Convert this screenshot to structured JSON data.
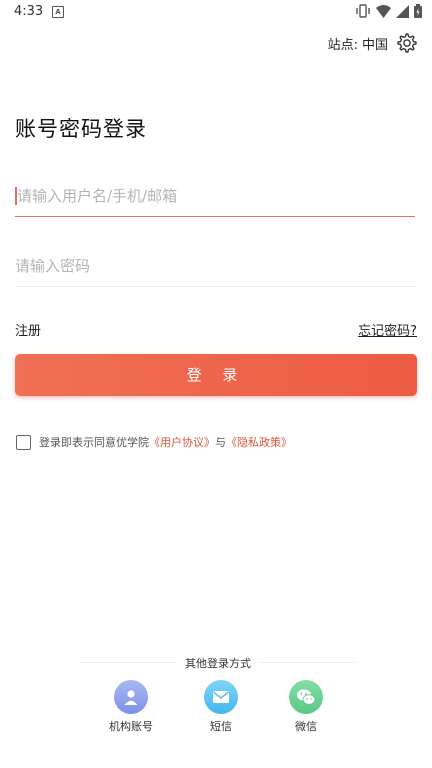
{
  "status_bar": {
    "time": "4:33",
    "notification_letter": "A"
  },
  "site": {
    "label": "站点:",
    "value": "中国"
  },
  "title": "账号密码登录",
  "username_field": {
    "value": "",
    "placeholder": "请输入用户名/手机/邮箱"
  },
  "password_field": {
    "value": "",
    "placeholder": "请输入密码"
  },
  "links": {
    "register": "注册",
    "forgot": "忘记密码?"
  },
  "login_button": "登 录",
  "agreement": {
    "checked": false,
    "prefix": "登录即表示同意优学院",
    "user_agreement": "《用户协议》",
    "conjunction": "与",
    "privacy_policy": "《隐私政策》"
  },
  "other_login": {
    "title": "其他登录方式",
    "methods": [
      {
        "label": "机构账号",
        "icon": "person-icon",
        "color": "#8ea1ee"
      },
      {
        "label": "短信",
        "icon": "mail-icon",
        "color": "#5ac2f2"
      },
      {
        "label": "微信",
        "icon": "wechat-icon",
        "color": "#6dd193"
      }
    ]
  },
  "colors": {
    "accent": "#ed5b44",
    "link": "#d4573f"
  }
}
